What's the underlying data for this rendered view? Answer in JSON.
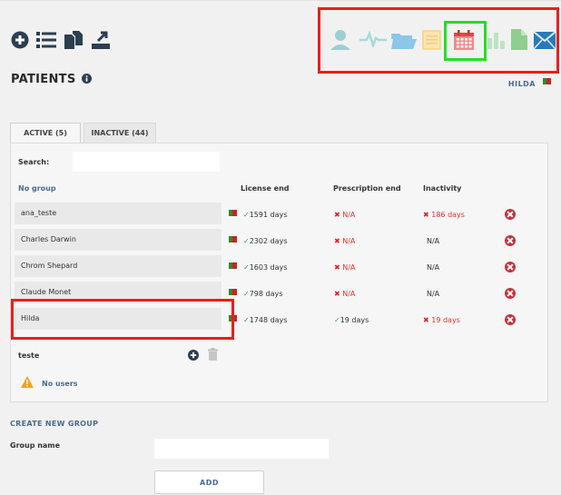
{
  "page": {
    "title": "PATIENTS",
    "username": "HILDA"
  },
  "tabs": {
    "active": "ACTIVE (5)",
    "inactive": "INACTIVE (44)"
  },
  "search": {
    "label": "Search:",
    "value": ""
  },
  "table": {
    "group_label": "No group",
    "columns": {
      "license": "License end",
      "prescription": "Prescription end",
      "inactivity": "Inactivity"
    },
    "rows": [
      {
        "name": "ana_teste",
        "license": "1591 days",
        "prescription": "N/A",
        "inactivity": "186 days"
      },
      {
        "name": "Charles Darwin",
        "license": "2302 days",
        "prescription": "N/A",
        "inactivity": "N/A"
      },
      {
        "name": "Chrom Shepard",
        "license": "1603 days",
        "prescription": "N/A",
        "inactivity": "N/A"
      },
      {
        "name": "Claude Monet",
        "license": "798 days",
        "prescription": "N/A",
        "inactivity": "N/A"
      },
      {
        "name": "Hilda",
        "license": "1748 days",
        "prescription": "19 days",
        "inactivity": "19 days"
      }
    ]
  },
  "group": {
    "name": "teste",
    "empty_text": "No users"
  },
  "create_group": {
    "title": "CREATE NEW GROUP",
    "name_label": "Group name",
    "name_value": "",
    "add_label": "ADD"
  },
  "colors": {
    "accent": "#4a6a90",
    "highlight_red": "#ee1c1c",
    "highlight_green": "#22e022",
    "danger": "#cc2222",
    "success": "#2aa44a"
  },
  "icons": {
    "left_toolbar": [
      "plus-circle-icon",
      "list-icon",
      "copy-files-icon",
      "export-icon"
    ],
    "right_toolbar": [
      "user-icon",
      "pulse-icon",
      "folder-open-icon",
      "document-icon",
      "calendar-icon",
      "bar-chart-icon",
      "file-icon",
      "envelope-icon"
    ]
  }
}
